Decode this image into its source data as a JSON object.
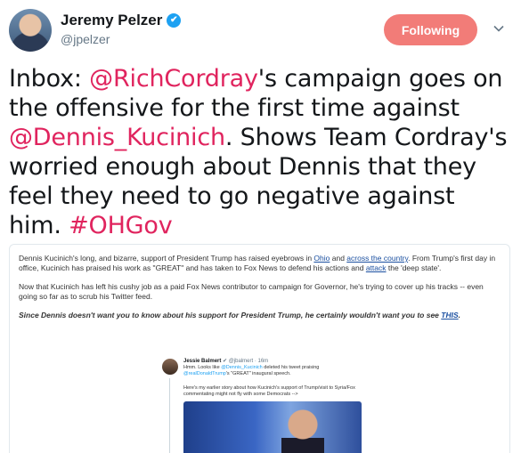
{
  "user": {
    "display_name": "Jeremy Pelzer",
    "handle": "@jpelzer",
    "verified_glyph": "✔"
  },
  "actions": {
    "following_label": "Following"
  },
  "tweet": {
    "t1": "Inbox: ",
    "m1": "@RichCordray",
    "t2": "'s campaign goes on the offensive for the first time against ",
    "m2": "@Dennis_Kucinich",
    "t3": ". Shows Team Cordray's worried enough about Dennis that they feel they need to go negative against him. ",
    "h1": "#OHGov"
  },
  "card": {
    "p1_a": "Dennis Kucinich's long, and bizarre, support of President Trump has raised eyebrows in ",
    "p1_l1": "Ohio",
    "p1_b": " and ",
    "p1_l2": "across the country",
    "p1_c": ". From Trump's first day in office, Kucinich has praised his work as \"GREAT\" and has taken to Fox News to defend his actions and ",
    "p1_l3": "attack",
    "p1_d": " the 'deep state'.",
    "p2": "Now that Kucinich has left his cushy job as a paid Fox News contributor to campaign for Governor, he's trying to cover up his tracks -- even going so far as to scrub his Twitter feed.",
    "p3_a": "Since Dennis doesn't want you to know about his support for President Trump, he certainly wouldn't want you to see ",
    "p3_l": "THIS",
    "p3_b": "."
  },
  "embed": {
    "name": "Jessie Balmert",
    "meta": " ✔ @jbalmert · 16m",
    "t_a": "Hmm. Looks like ",
    "t_m1": "@Dennis_Kucinich",
    "t_b": " deleted his tweet praising ",
    "t_m2": "@realDonaldTrump",
    "t_c": "'s \"GREAT\" inaugural speech.",
    "t2": "Here's my earlier story about how Kucinich's support of Trump/visit to Syria/Fox commentating might not fly with some Democrats -->"
  },
  "colors": {
    "mention": "#e0245e",
    "follow_button": "#f27c78",
    "verified": "#1da1f2"
  }
}
